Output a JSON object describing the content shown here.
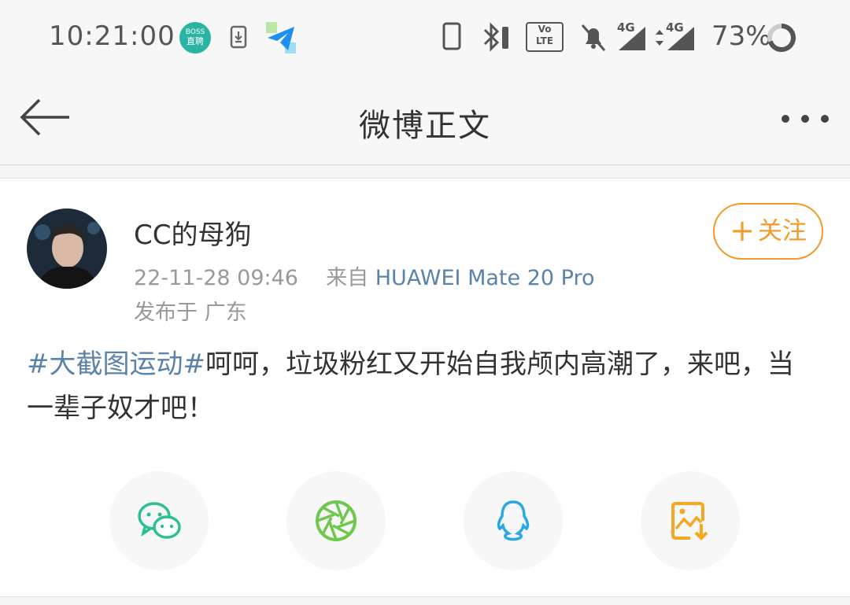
{
  "status_bar": {
    "time": "10:21:00",
    "boss_app_label_top": "BOSS",
    "boss_app_label_bottom": "直聘",
    "battery_percent": "73%",
    "network_4g_1": "4G",
    "network_4g_2": "4G",
    "volte_label_top": "Vo",
    "volte_label_bottom": "LTE",
    "icons": [
      "boss-zhipin-icon",
      "download-icon",
      "paper-plane-icon",
      "phone-icon",
      "bluetooth-icon",
      "volte-icon",
      "mute-icon",
      "signal-icon",
      "signal-icon",
      "battery-icon"
    ]
  },
  "nav": {
    "title": "微博正文",
    "back_icon": "arrow-left-icon",
    "more_icon": "more-dots-icon"
  },
  "post": {
    "username": "CC的母狗",
    "time": "22-11-28 09:46",
    "source_prefix": "来自",
    "source_device": "HUAWEI Mate 20 Pro",
    "location": "发布于 广东",
    "follow_plus": "+",
    "follow_label": "关注",
    "topic": "#大截图运动#",
    "text": "呵呵，垃圾粉红又开始自我颅内高潮了，来吧，当一辈子奴才吧！"
  },
  "share": {
    "items": [
      {
        "icon": "wechat-icon",
        "color": "#2bbf94"
      },
      {
        "icon": "moments-aperture-icon",
        "color": "#6dc84c"
      },
      {
        "icon": "qq-penguin-icon",
        "color": "#2aa8e6"
      },
      {
        "icon": "save-image-icon",
        "color": "#f5a623"
      }
    ]
  },
  "colors": {
    "accent_orange": "#f39a2c",
    "link_blue": "#5b82a8",
    "meta_gray": "#999999"
  }
}
